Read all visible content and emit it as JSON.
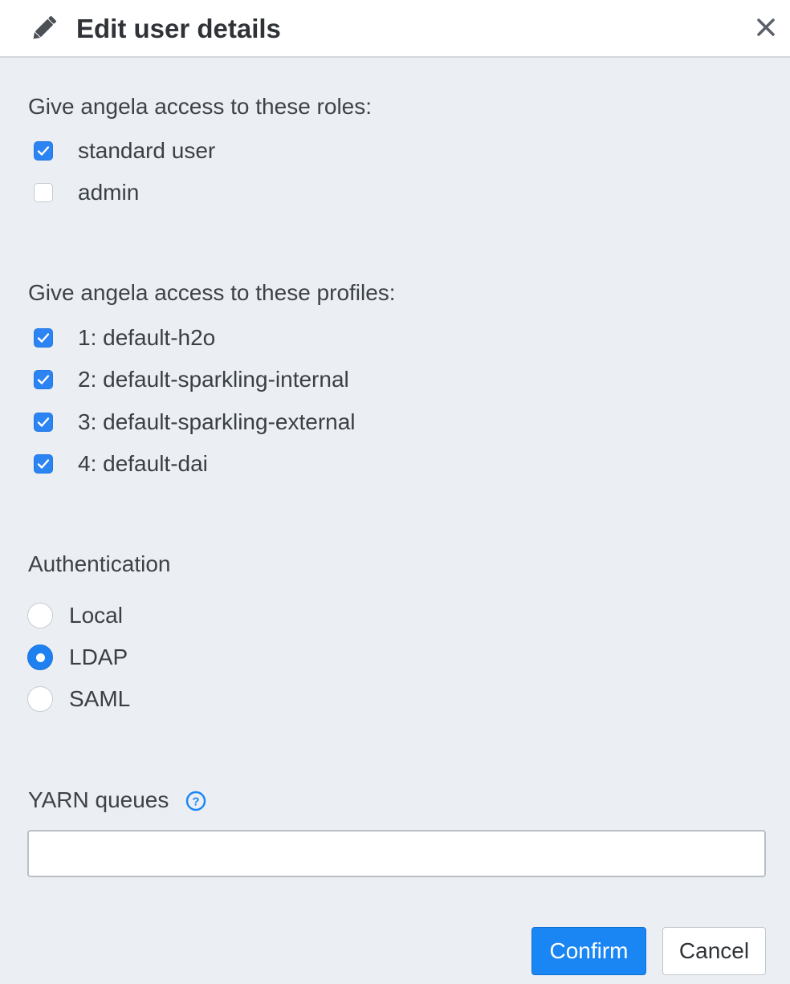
{
  "dialog": {
    "title": "Edit user details",
    "icon": "pencil-icon",
    "close_icon": "close-icon"
  },
  "roles": {
    "label": "Give angela access to these roles:",
    "items": [
      {
        "label": "standard user",
        "checked": true
      },
      {
        "label": "admin",
        "checked": false
      }
    ]
  },
  "profiles": {
    "label": "Give angela access to these profiles:",
    "items": [
      {
        "label": "1: default-h2o",
        "checked": true
      },
      {
        "label": "2: default-sparkling-internal",
        "checked": true
      },
      {
        "label": "3: default-sparkling-external",
        "checked": true
      },
      {
        "label": "4: default-dai",
        "checked": true
      }
    ]
  },
  "authentication": {
    "label": "Authentication",
    "options": [
      {
        "label": "Local",
        "selected": false
      },
      {
        "label": "LDAP",
        "selected": true
      },
      {
        "label": "SAML",
        "selected": false
      }
    ]
  },
  "yarn": {
    "label": "YARN queues",
    "help_icon": "help-circle-icon",
    "value": "",
    "placeholder": ""
  },
  "buttons": {
    "confirm": "Confirm",
    "cancel": "Cancel"
  },
  "colors": {
    "accent": "#1a86f4",
    "background": "#ebeff3",
    "header": "#ffffff"
  }
}
